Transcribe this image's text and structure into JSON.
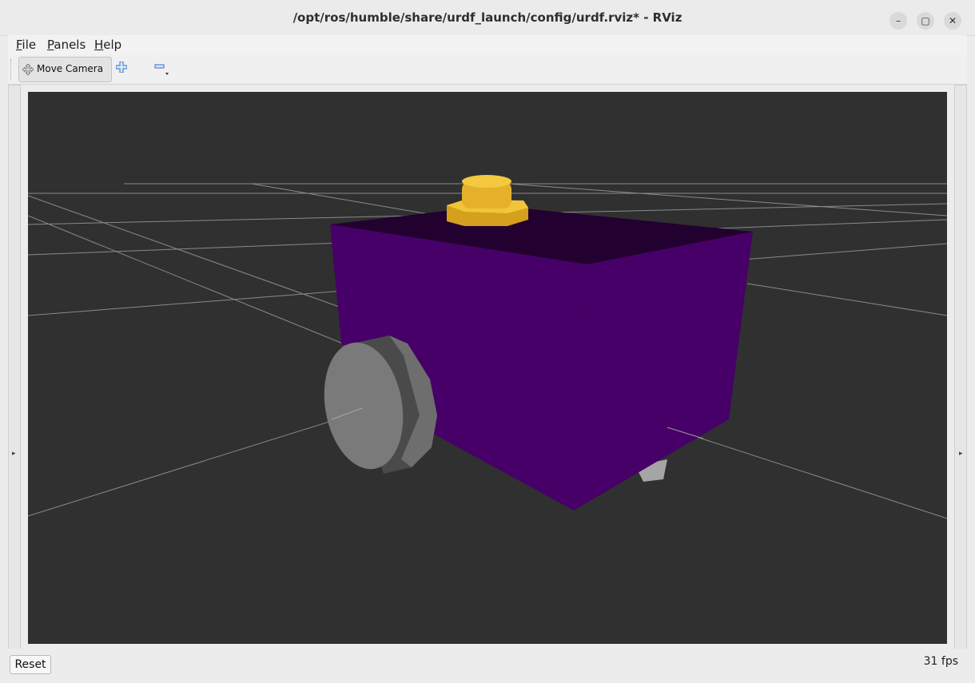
{
  "window": {
    "title": "/opt/ros/humble/share/urdf_launch/config/urdf.rviz* - RViz",
    "controls": {
      "minimize": "–",
      "maximize": "▢",
      "close": "✕"
    }
  },
  "menubar": {
    "items": [
      {
        "label": "File",
        "mnemonic": "F",
        "rest": "ile"
      },
      {
        "label": "Panels",
        "mnemonic": "P",
        "rest": "anels"
      },
      {
        "label": "Help",
        "mnemonic": "H",
        "rest": "elp"
      }
    ]
  },
  "toolbar": {
    "move_camera_label": "Move Camera",
    "icons": [
      "move-camera-icon",
      "add-tool-icon",
      "remove-tool-icon"
    ]
  },
  "side_panels": {
    "left_arrow": "▸",
    "right_arrow": "▸"
  },
  "viewport": {
    "background": "#303030",
    "robot": {
      "body_color": "#460068",
      "top_color": "#22002f",
      "sensor_color": "#e8b42a",
      "wheel_color": "#808080"
    }
  },
  "statusbar": {
    "reset_label": "Reset",
    "fps": "31 fps"
  }
}
